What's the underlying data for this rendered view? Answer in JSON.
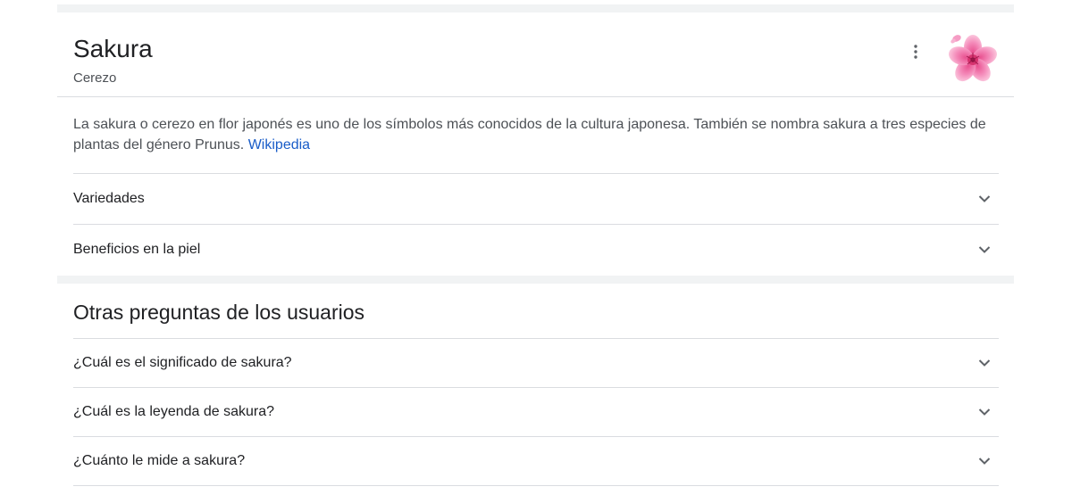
{
  "knowledge_panel": {
    "title": "Sakura",
    "subtitle": "Cerezo",
    "description": "La sakura o cerezo en flor japonés es uno de los símbolos más conocidos de la cultura japonesa. También se nombra sakura a tres especies de plantas del género Prunus.",
    "source_link": "Wikipedia",
    "expanders": [
      {
        "label": "Variedades"
      },
      {
        "label": "Beneficios en la piel"
      }
    ]
  },
  "people_also_ask": {
    "title": "Otras preguntas de los usuarios",
    "questions": [
      {
        "label": "¿Cuál es el significado de sakura?"
      },
      {
        "label": "¿Cuál es la leyenda de sakura?"
      },
      {
        "label": "¿Cuánto le mide a sakura?"
      }
    ]
  },
  "icons": {
    "more": "more-vert-icon",
    "expand": "chevron-down-icon",
    "image": "cherry-blossom-image"
  },
  "colors": {
    "link": "#1a5dc8",
    "text": "#202124",
    "secondary_text": "#4d5156",
    "divider": "#dadce0",
    "band": "#f1f3f4"
  }
}
